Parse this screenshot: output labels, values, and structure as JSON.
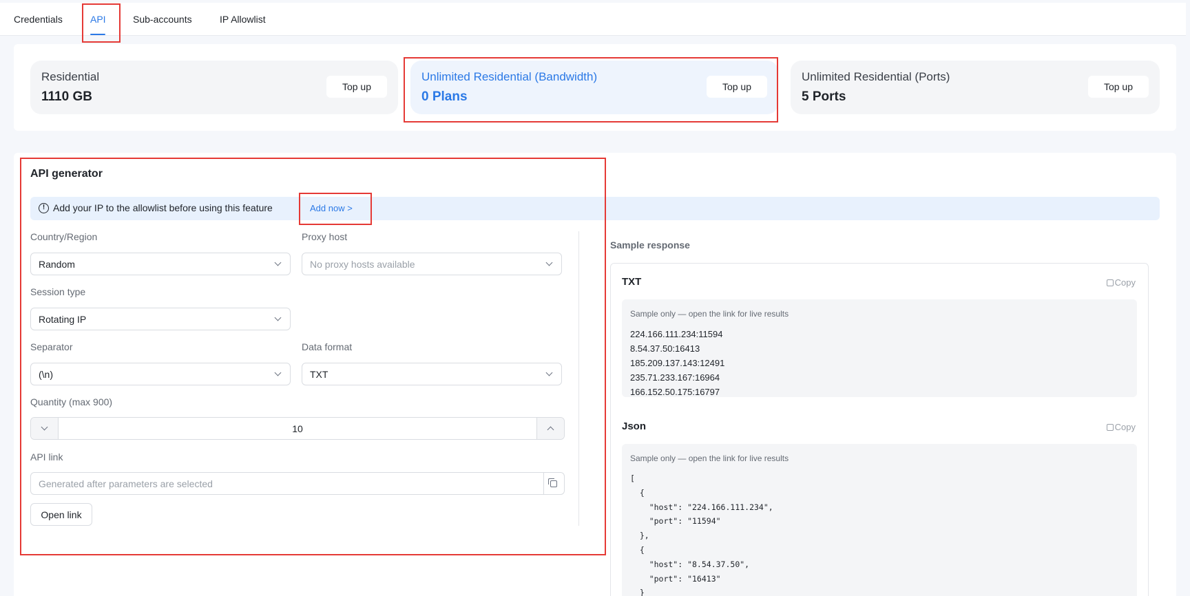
{
  "tabs": [
    "Credentials",
    "API",
    "Sub-accounts",
    "IP Allowlist"
  ],
  "plans": [
    {
      "title": "Residential",
      "value": "1110 GB",
      "button": "Top up"
    },
    {
      "title": "Unlimited Residential (Bandwidth)",
      "value": "0 Plans",
      "button": "Top up"
    },
    {
      "title": "Unlimited Residential (Ports)",
      "value": "5 Ports",
      "button": "Top up"
    }
  ],
  "generator": {
    "title": "API generator",
    "notice_icon": "!",
    "notice": "Add your IP to the allowlist before using this feature",
    "notice_link": "Add now >",
    "country_label": "Country/Region",
    "country_value": "Random",
    "proxy_host_label": "Proxy host",
    "proxy_host_value": "No proxy hosts available",
    "session_label": "Session type",
    "session_value": "Rotating IP",
    "separator_label": "Separator",
    "separator_value": "(\\n)",
    "format_label": "Data format",
    "format_value": "TXT",
    "quantity_label": "Quantity (max 900)",
    "quantity_value": "10",
    "api_link_label": "API link",
    "api_link_placeholder": "Generated after parameters are selected",
    "open_link": "Open link"
  },
  "sample": {
    "title": "Sample response",
    "copy_label": "Copy",
    "note": "Sample only — open the link for live results",
    "txt_title": "TXT",
    "txt_lines": [
      "224.166.111.234:11594",
      "8.54.37.50:16413",
      "185.209.137.143:12491",
      "235.71.233.167:16964",
      "166.152.50.175:16797"
    ],
    "json_title": "Json",
    "json_text": "[\n  {\n    \"host\": \"224.166.111.234\",\n    \"port\": \"11594\"\n  },\n  {\n    \"host\": \"8.54.37.50\",\n    \"port\": \"16413\"\n  }"
  },
  "colors": {
    "accent": "#2b79e6",
    "annotation": "#e53935"
  }
}
